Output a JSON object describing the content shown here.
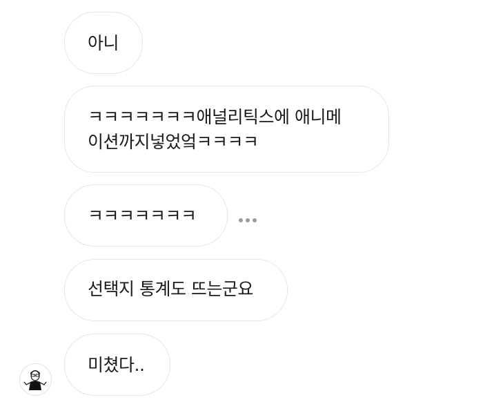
{
  "messages": [
    {
      "text": "아니"
    },
    {
      "text": "ㅋㅋㅋㅋㅋㅋㅋ애널리틱스에 애니메\n이션까지넣었엌ㅋㅋㅋㅋ"
    },
    {
      "text": "ㅋㅋㅋㅋㅋㅋㅋ"
    },
    {
      "text": "선택지 통계도 뜨는군요"
    },
    {
      "text": "미쳤다.."
    }
  ],
  "icons": {
    "more": "more-horizontal-icon",
    "avatar": "avatar-illustration"
  },
  "colors": {
    "bubble_border": "#e6e6e6",
    "text": "#1a1a1a",
    "more_dots": "#9a9a9a"
  }
}
